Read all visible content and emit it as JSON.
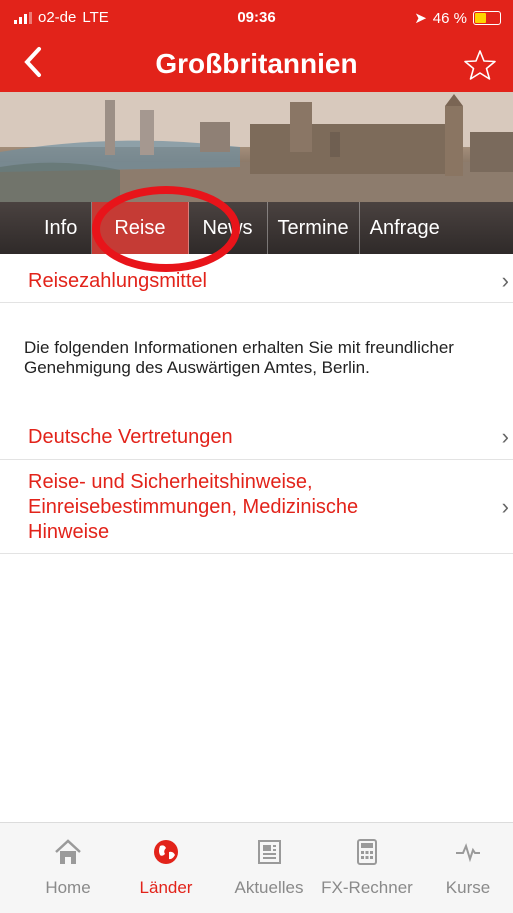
{
  "status_bar": {
    "carrier": "o2-de",
    "network": "LTE",
    "time": "09:36",
    "battery": "46 %",
    "battery_level": 0.46
  },
  "nav": {
    "title": "Großbritannien",
    "back_icon": "chevron-left-icon",
    "favorite_icon": "star-outline-icon"
  },
  "tabs": [
    {
      "label": "Info",
      "active": false
    },
    {
      "label": "Reise",
      "active": true
    },
    {
      "label": "News",
      "active": false
    },
    {
      "label": "Termine",
      "active": false
    },
    {
      "label": "Anfrage",
      "active": false
    }
  ],
  "list": {
    "item1": "Reisezahlungsmittel",
    "info_text": "Die folgenden Informationen erhalten Sie mit freundlicher Genehmigung des Auswärtigen Amtes, Berlin.",
    "item2": "Deutsche Vertretungen",
    "item3": "Reise- und Sicherheitshinweise, Einreisebestimmungen, Medizinische Hinweise",
    "chevron": "›"
  },
  "tabbar": {
    "items": [
      {
        "label": "Home",
        "icon": "house-icon",
        "active": false
      },
      {
        "label": "Länder",
        "icon": "globe-icon",
        "active": true
      },
      {
        "label": "Aktuelles",
        "icon": "newspaper-icon",
        "active": false
      },
      {
        "label": "FX-Rechner",
        "icon": "calculator-icon",
        "active": false
      },
      {
        "label": "Kurse",
        "icon": "chart-line-icon",
        "active": false
      }
    ]
  },
  "colors": {
    "brand_red": "#e2231a",
    "annotation_circle": "#e8141a"
  }
}
